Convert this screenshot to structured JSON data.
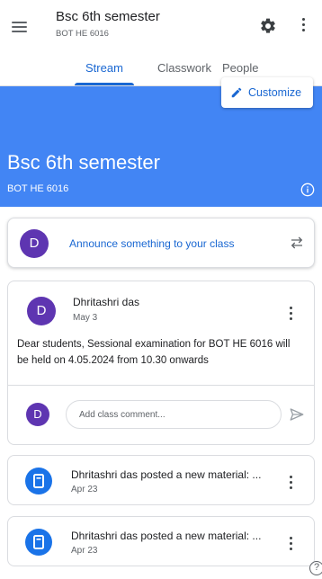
{
  "topbar": {
    "title": "Bsc 6th semester",
    "subtitle": "BOT HE 6016",
    "icons": [
      "menu-icon",
      "settings-icon",
      "more-vert-icon"
    ]
  },
  "tabs": [
    {
      "label": "Stream",
      "active": true
    },
    {
      "label": "Classwork",
      "active": false
    },
    {
      "label": "People",
      "active": false
    }
  ],
  "banner": {
    "customize_label": "Customize",
    "title": "Bsc 6th semester",
    "subtitle": "BOT HE 6016",
    "color": "#4285f4"
  },
  "announce": {
    "avatar_letter": "D",
    "placeholder": "Announce something to your class"
  },
  "post": {
    "avatar_letter": "D",
    "author": "Dhritashri das",
    "date": "May 3",
    "body": "Dear students, Sessional examination for BOT HE 6016 will be held on 4.05.2024 from 10.30 onwards",
    "comment_avatar_letter": "D",
    "comment_placeholder": "Add class comment..."
  },
  "materials": [
    {
      "title": "Dhritashri das posted a new material: ...",
      "date": "Apr 23"
    },
    {
      "title": "Dhritashri das posted a new material: ...",
      "date": "Apr 23"
    }
  ],
  "colors": {
    "accent": "#1967d2",
    "avatar": "#5e35b1",
    "material_icon": "#1a73e8"
  }
}
